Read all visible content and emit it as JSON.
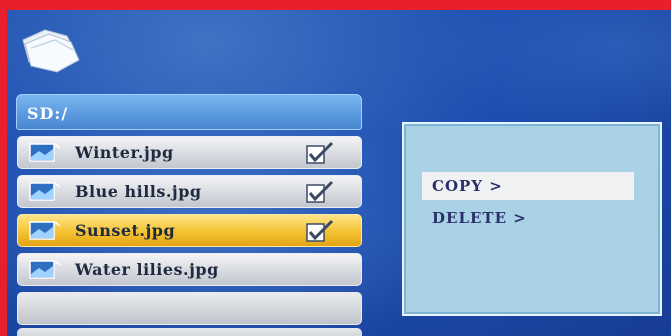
{
  "header": {
    "folder_icon": "folder-icon"
  },
  "path": {
    "label": "SD:/"
  },
  "files": [
    {
      "name": "Winter.jpg",
      "icon": "image-file-icon",
      "checked": true,
      "selected": false
    },
    {
      "name": "Blue hills.jpg",
      "icon": "image-file-icon",
      "checked": true,
      "selected": false
    },
    {
      "name": "Sunset.jpg",
      "icon": "image-file-icon",
      "checked": true,
      "selected": true
    },
    {
      "name": "Water lilies.jpg",
      "icon": "image-file-icon",
      "checked": false,
      "selected": false
    }
  ],
  "menu": {
    "items": [
      {
        "label": "COPY >",
        "highlighted": true
      },
      {
        "label": "DELETE >",
        "highlighted": false
      }
    ]
  },
  "colors": {
    "frame": "#e8202e",
    "background": "#1e4fb1",
    "selected_row": "#f4c232",
    "menu_panel": "#a9d2e6",
    "menu_text": "#2b2f6a"
  }
}
